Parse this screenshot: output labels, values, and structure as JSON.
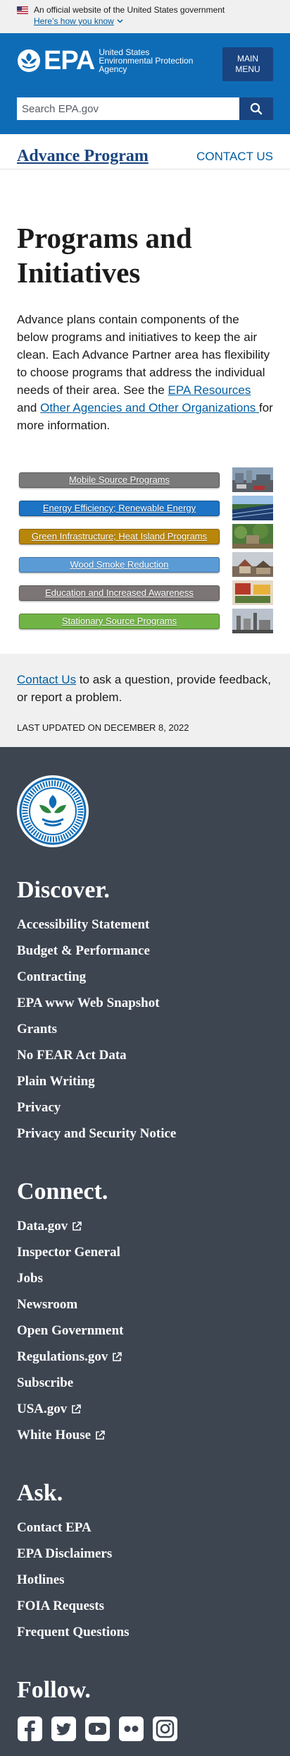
{
  "banner": {
    "text": "An official website of the United States government",
    "link": "Here’s how you know"
  },
  "header": {
    "logo_abbrev": "EPA",
    "logo_line1": "United States",
    "logo_line2": "Environmental Protection",
    "logo_line3": "Agency",
    "menu_line1": "Main",
    "menu_line2": "Menu",
    "search_placeholder": "Search EPA.gov"
  },
  "section_nav": {
    "title": "Advance Program",
    "contact": "Contact Us"
  },
  "main": {
    "heading": "Programs and Initiatives",
    "intro_text": "Advance plans contain components of the below programs and initiatives to keep the air clean. Each Advance Partner area has flexibility to choose programs that address the individual needs of their area. See the ",
    "intro_link1": "EPA Resources",
    "intro_mid": " and ",
    "intro_link2": "Other Agencies and Other Organizations ",
    "intro_end": "for more information.",
    "programs": [
      {
        "label": "Mobile Source Programs",
        "color": "#7a7a7a"
      },
      {
        "label": "Energy Efficiency; Renewable Energy",
        "color": "#1d73c4"
      },
      {
        "label": "Green Infrastructure; Heat Island Programs",
        "color": "#b8860b"
      },
      {
        "label": "Wood Smoke Reduction",
        "color": "#5b9bd5"
      },
      {
        "label": "Education and Increased Awareness",
        "color": "#7b7576"
      },
      {
        "label": "Stationary Source Programs",
        "color": "#71b446"
      }
    ]
  },
  "contact_box": {
    "link": "Contact Us",
    "text": " to ask a question, provide feedback, or report a problem.",
    "updated": "Last updated on December 8, 2022"
  },
  "footer": {
    "discover_title": "Discover.",
    "discover": [
      "Accessibility Statement",
      "Budget & Performance",
      "Contracting",
      "EPA www Web Snapshot",
      "Grants",
      "No FEAR Act Data",
      "Plain Writing",
      "Privacy",
      "Privacy and Security Notice"
    ],
    "connect_title": "Connect.",
    "connect": [
      "Data.gov",
      "Inspector General",
      "Jobs",
      "Newsroom",
      "Open Government",
      "Regulations.gov",
      "Subscribe",
      "USA.gov",
      "White House"
    ],
    "ask_title": "Ask.",
    "ask": [
      "Contact EPA",
      "EPA Disclaimers",
      "Hotlines",
      "FOIA Requests",
      "Frequent Questions"
    ],
    "follow_title": "Follow.",
    "social_icons": [
      "facebook-icon",
      "twitter-icon",
      "youtube-icon",
      "flickr-icon",
      "instagram-icon"
    ]
  }
}
